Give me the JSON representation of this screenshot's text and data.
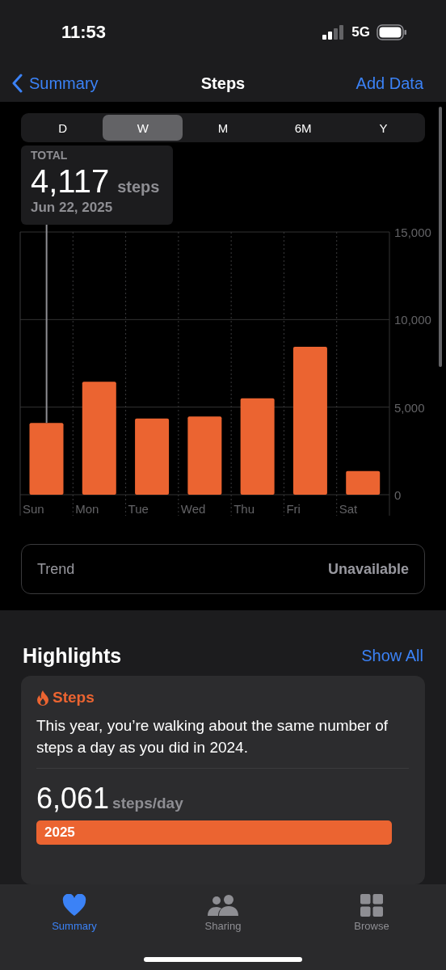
{
  "status_bar": {
    "time": "11:53",
    "network": "5G"
  },
  "nav": {
    "back": "Summary",
    "title": "Steps",
    "action": "Add Data"
  },
  "segments": [
    {
      "label": "D",
      "selected": false
    },
    {
      "label": "W",
      "selected": true
    },
    {
      "label": "M",
      "selected": false
    },
    {
      "label": "6M",
      "selected": false
    },
    {
      "label": "Y",
      "selected": false
    }
  ],
  "callout": {
    "label": "TOTAL",
    "value": "4,117",
    "unit": "steps",
    "date": "Jun 22, 2025"
  },
  "chart_data": {
    "type": "bar",
    "categories": [
      "Sun",
      "Mon",
      "Tue",
      "Wed",
      "Thu",
      "Fri",
      "Sat"
    ],
    "series": [
      {
        "color": "#eb6431",
        "values": [
          4100,
          6450,
          4350,
          4470,
          5500,
          8450,
          1350
        ]
      }
    ],
    "ylim": [
      0,
      15000
    ],
    "yticks": [
      {
        "value": 0,
        "label": "0"
      },
      {
        "value": 5000,
        "label": "5,000"
      },
      {
        "value": 10000,
        "label": "10,000"
      },
      {
        "value": 15000,
        "label": "15,000"
      }
    ]
  },
  "trend": {
    "label": "Trend",
    "value": "Unavailable"
  },
  "highlights": {
    "title": "Highlights",
    "action": "Show All",
    "card": {
      "category": "Steps",
      "text": "This year, you’re walking about the same number of steps a day as you did in 2024.",
      "stats": [
        {
          "value": "6,061",
          "unit": "steps/day",
          "bar_label": "2025"
        }
      ]
    }
  },
  "tab_bar": [
    {
      "label": "Summary",
      "kind": "heart",
      "selected": true
    },
    {
      "label": "Sharing",
      "kind": "people",
      "selected": false
    },
    {
      "label": "Browse",
      "kind": "grid",
      "selected": false
    }
  ]
}
